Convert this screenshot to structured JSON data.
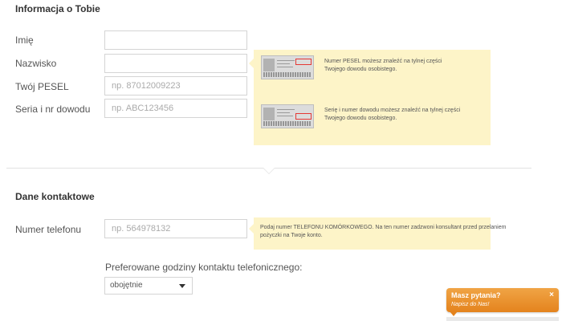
{
  "personal": {
    "title": "Informacja o Tobie",
    "fields": [
      {
        "label": "Imię",
        "value": "",
        "placeholder": ""
      },
      {
        "label": "Nazwisko",
        "value": "",
        "placeholder": ""
      },
      {
        "label": "Twój PESEL",
        "value": "",
        "placeholder": "np. 87012009223"
      },
      {
        "label": "Seria i nr dowodu",
        "value": "",
        "placeholder": "np. ABC123456"
      }
    ],
    "hints": [
      {
        "line1": "Numer PESEL możesz znaleźć na tylnej części",
        "line2": "Twojego dowodu osobistego."
      },
      {
        "line1": "Serię i numer dowodu możesz znaleźć na tylnej części",
        "line2": "Twojego dowodu osobistego."
      }
    ]
  },
  "contact": {
    "title": "Dane kontaktowe",
    "phone": {
      "label": "Numer telefonu",
      "value": "",
      "placeholder": "np. 564978132"
    },
    "phone_hint": {
      "line1": "Podaj numer TELEFONU KOMÓRKOWEGO. Na ten numer zadzwoni konsultant przed przelaniem",
      "line2": "pożyczki na Twoje konto."
    },
    "hours_label": "Preferowane godziny kontaktu telefonicznego:",
    "hours_selected": "obojętnie"
  },
  "chat": {
    "title": "Masz pytania?",
    "subtitle": "Napisz do Nas!",
    "close": "×"
  },
  "colors": {
    "hint_background": "#fdf4c8",
    "chat_orange": "#e4831d",
    "id_highlight": "#e53935"
  }
}
